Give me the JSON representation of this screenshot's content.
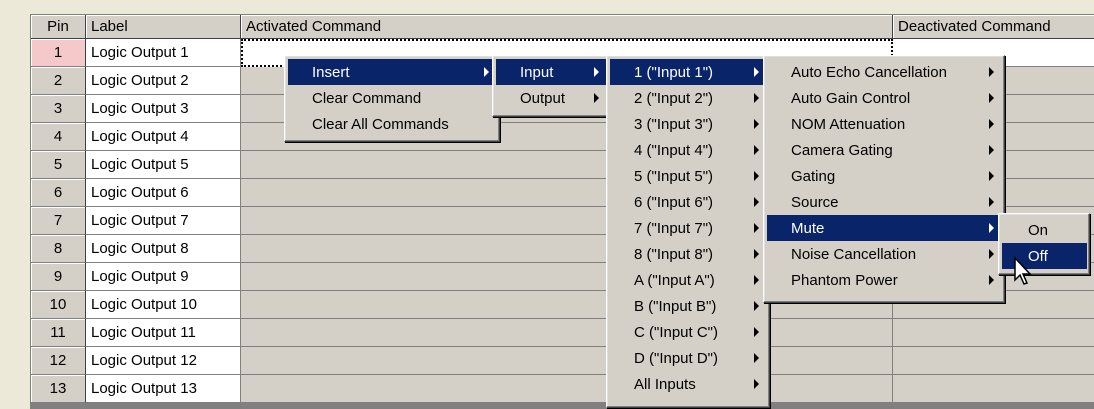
{
  "grid": {
    "headers": {
      "pin": "Pin",
      "label": "Label",
      "activated": "Activated Command",
      "deactivated": "Deactivated Command"
    },
    "rows": [
      {
        "pin": "1",
        "label": "Logic Output 1"
      },
      {
        "pin": "2",
        "label": "Logic Output 2"
      },
      {
        "pin": "3",
        "label": "Logic Output 3"
      },
      {
        "pin": "4",
        "label": "Logic Output 4"
      },
      {
        "pin": "5",
        "label": "Logic Output 5"
      },
      {
        "pin": "6",
        "label": "Logic Output 6"
      },
      {
        "pin": "7",
        "label": "Logic Output 7"
      },
      {
        "pin": "8",
        "label": "Logic Output 8"
      },
      {
        "pin": "9",
        "label": "Logic Output 9"
      },
      {
        "pin": "10",
        "label": "Logic Output 10"
      },
      {
        "pin": "11",
        "label": "Logic Output 11"
      },
      {
        "pin": "12",
        "label": "Logic Output 12"
      },
      {
        "pin": "13",
        "label": "Logic Output 13"
      }
    ]
  },
  "context_menu": {
    "items": [
      "Insert",
      "Clear Command",
      "Clear All Commands"
    ]
  },
  "insert_submenu": {
    "items": [
      "Input",
      "Output"
    ]
  },
  "input_submenu": {
    "items": [
      "1 (\"Input 1\")",
      "2 (\"Input 2\")",
      "3 (\"Input 3\")",
      "4 (\"Input 4\")",
      "5 (\"Input 5\")",
      "6 (\"Input 6\")",
      "7 (\"Input 7\")",
      "8 (\"Input 8\")",
      "A (\"Input A\")",
      "B (\"Input B\")",
      "C (\"Input C\")",
      "D (\"Input D\")",
      "All Inputs"
    ]
  },
  "input1_submenu": {
    "items": [
      "Auto Echo Cancellation",
      "Auto Gain Control",
      "NOM Attenuation",
      "Camera Gating",
      "Gating",
      "Source",
      "Mute",
      "Noise Cancellation",
      "Phantom Power"
    ]
  },
  "mute_submenu": {
    "items": [
      "On",
      "Off"
    ]
  },
  "colors": {
    "selection": "#0a246a",
    "active_pin": "#f5c9c9",
    "face": "#d4d0c8"
  }
}
